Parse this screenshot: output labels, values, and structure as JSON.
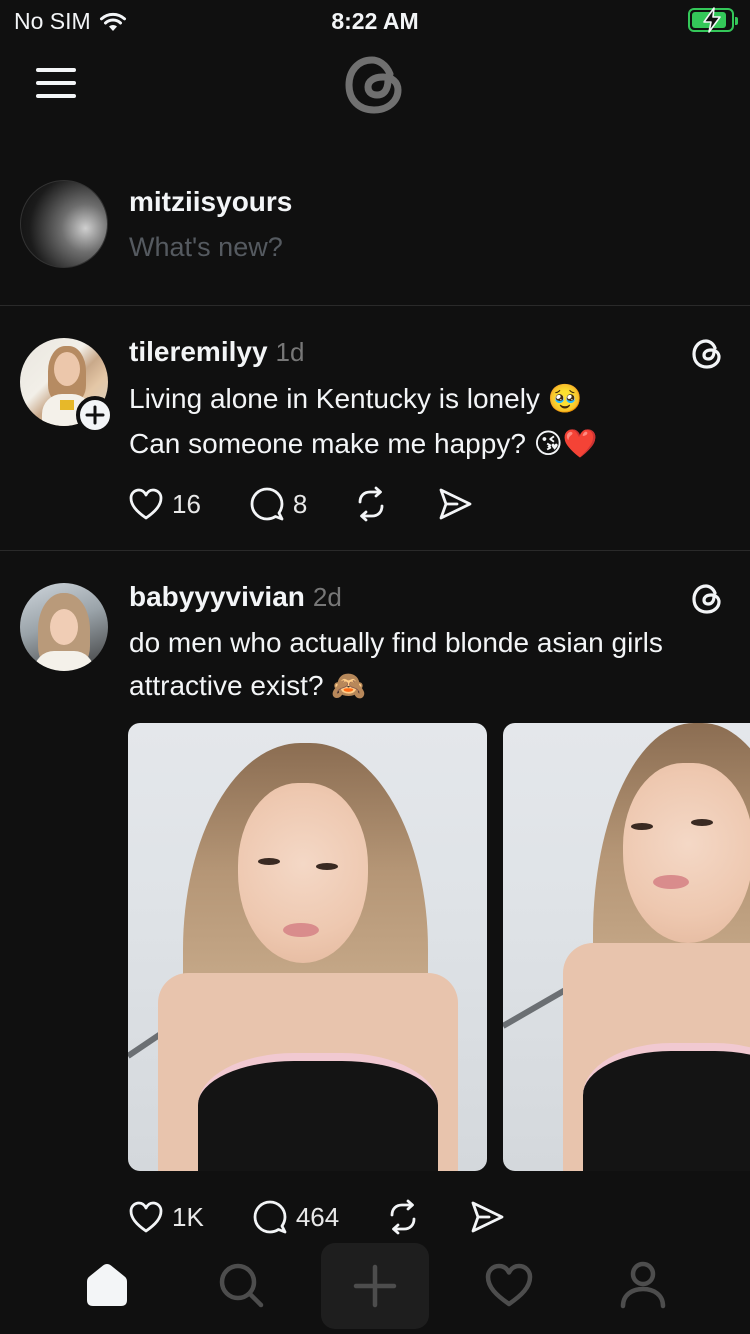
{
  "status_bar": {
    "carrier": "No SIM",
    "time": "8:22 AM",
    "battery_color": "#34c759"
  },
  "top_bar": {
    "menu_icon": "hamburger-menu-icon",
    "logo_icon": "threads-logo-icon"
  },
  "composer": {
    "username": "mitziisyours",
    "placeholder": "What's new?"
  },
  "posts": [
    {
      "username": "tileremilyy",
      "time": "1d",
      "lines": [
        "Living alone in Kentucky is lonely 🥹",
        "Can someone make me happy? 😘❤️"
      ],
      "likes": "16",
      "replies": "8",
      "has_follow_button": true
    },
    {
      "username": "babyyyvivian",
      "time": "2d",
      "lines": [
        "do men who actually find blonde asian girls",
        "attractive exist? 🙈"
      ],
      "likes": "1K",
      "replies": "464",
      "images": 2
    }
  ],
  "tab_bar": {
    "items": [
      "home-icon",
      "search-icon",
      "new-thread-icon",
      "activity-heart-icon",
      "profile-icon"
    ],
    "active": "home-icon"
  },
  "colors": {
    "background": "#101010",
    "text": "#f3f5f7",
    "muted": "#777777",
    "divider": "#2a2a2a"
  }
}
